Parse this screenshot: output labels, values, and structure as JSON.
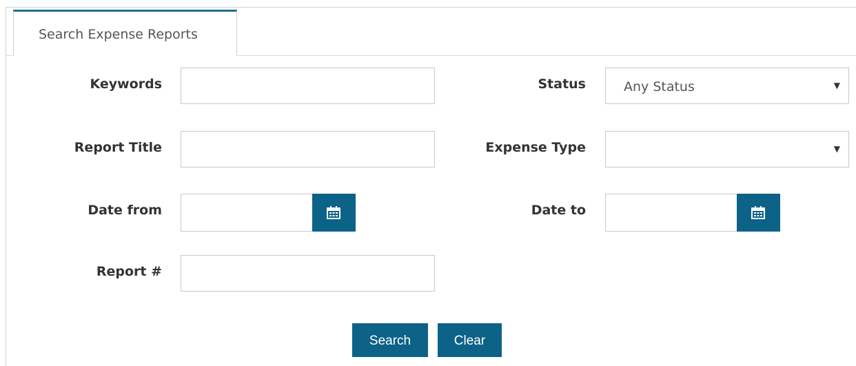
{
  "tabs": [
    {
      "label": "Search Expense Reports",
      "active": true
    }
  ],
  "form": {
    "keywords": {
      "label": "Keywords",
      "value": "",
      "placeholder": ""
    },
    "report_title": {
      "label": "Report Title",
      "value": "",
      "placeholder": ""
    },
    "date_from": {
      "label": "Date from",
      "value": ""
    },
    "report_number": {
      "label": "Report #",
      "value": ""
    },
    "status": {
      "label": "Status",
      "selected": "Any Status"
    },
    "expense_type": {
      "label": "Expense Type",
      "selected": ""
    },
    "date_to": {
      "label": "Date to",
      "value": ""
    }
  },
  "actions": {
    "search_label": "Search",
    "clear_label": "Clear"
  },
  "icons": {
    "calendar": "calendar-icon",
    "dropdown": "chevron-down-icon"
  },
  "colors": {
    "accent": "#0d6288",
    "tab_border": "#1e6f93",
    "input_border": "#c8c8c8"
  }
}
